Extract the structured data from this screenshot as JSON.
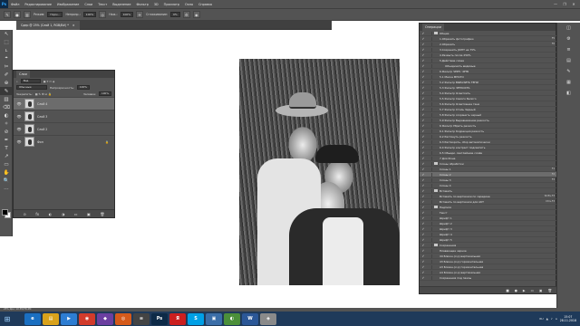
{
  "app": {
    "logo": "Ps",
    "menu": [
      "Файл",
      "Редактирование",
      "Изображение",
      "Слои",
      "Текст",
      "Выделение",
      "Фильтр",
      "3D",
      "Просмотр",
      "Окно",
      "Справка"
    ],
    "window_controls": [
      "—",
      "❐",
      "✕"
    ]
  },
  "options": {
    "mode_label": "Режим:",
    "mode_value": "Норм...",
    "opacity_label": "Непрозр.:",
    "opacity_value": "100%",
    "flow_label": "Наж.:",
    "flow_value": "100%",
    "smooth_label": "Сглаживание:",
    "smooth_value": "0%"
  },
  "document": {
    "tab_label": "Сдер @ 25% (Слой 1, RGB/8#) *",
    "close": "×"
  },
  "tools": [
    "↖",
    "⬚",
    "ʟ",
    "⌖",
    "✂",
    "✐",
    "⊕",
    "✎",
    "▥",
    "⌫",
    "◐",
    "✧",
    "⊘",
    "✒",
    "T",
    "↗",
    "▭",
    "✋",
    "🔍",
    "⋯"
  ],
  "layers_panel": {
    "tab": "Слои",
    "kind_label": "Вид",
    "blend_mode": "Обычные",
    "opacity_label": "Непрозрачность:",
    "opacity_value": "100%",
    "lock_label": "Закрепить:",
    "fill_label": "Заливка:",
    "fill_value": "100%",
    "layers": [
      {
        "name": "Слой 4",
        "selected": true
      },
      {
        "name": "Слой 3",
        "selected": false
      },
      {
        "name": "Слой 2",
        "selected": false
      },
      {
        "name": "Фон",
        "selected": false
      }
    ],
    "footer_icons": [
      "⊙",
      "fx",
      "◐",
      "◑",
      "▭",
      "▣",
      "🗑"
    ]
  },
  "actions_panel": {
    "tab": "Операции",
    "items": [
      {
        "level": 0,
        "folder": true,
        "name": "Общие",
        "key": ""
      },
      {
        "level": 1,
        "name": "1.Обрезать фотографию",
        "key": "F5"
      },
      {
        "level": 1,
        "name": "2.Обрезать",
        "key": "F6"
      },
      {
        "level": 1,
        "name": "3.Сохранить JOIHT на 75%",
        "key": ""
      },
      {
        "level": 1,
        "name": "4.Размыть после 250%",
        "key": ""
      },
      {
        "level": 1,
        "name": "5.Действие слоев",
        "key": ""
      },
      {
        "level": 2,
        "name": "Объединить видимые",
        "key": ""
      },
      {
        "level": 1,
        "name": "6.Фильтр ЧЕРН. ЧРТБ",
        "key": ""
      },
      {
        "level": 1,
        "name": "5.1 Маска МНОГО",
        "key": ""
      },
      {
        "level": 1,
        "name": "5.2 Фильтр ВЫРАЗИТЬ ТЕНИ",
        "key": ""
      },
      {
        "level": 1,
        "name": "5.3 Фильтр ЧЕТКОСТЬ",
        "key": ""
      },
      {
        "level": 1,
        "name": "5.4 Фильтр Осветлить",
        "key": ""
      },
      {
        "level": 1,
        "name": "5.5 Фильтр Самого Белого",
        "key": ""
      },
      {
        "level": 1,
        "name": "5.6 Фильтр Осветление тени",
        "key": ""
      },
      {
        "level": 1,
        "name": "5.7 Фильтр Стиль Черный",
        "key": ""
      },
      {
        "level": 1,
        "name": "5.8 Фильтр сохранить черный",
        "key": ""
      },
      {
        "level": 1,
        "name": "5.9 Фильтр Выравнивание резкость",
        "key": ""
      },
      {
        "level": 1,
        "name": "6 Фильтр Убрать резкость",
        "key": ""
      },
      {
        "level": 1,
        "name": "6.1 Фильтр Коррекция резкость",
        "key": ""
      },
      {
        "level": 1,
        "name": "6.2 Растянуть резкость",
        "key": ""
      },
      {
        "level": 1,
        "name": "6.3 Растворить, сбор автоматически",
        "key": ""
      },
      {
        "level": 1,
        "name": "6.4 Фильтр контраст подсветить",
        "key": ""
      },
      {
        "level": 1,
        "name": "6.5 Обьеди. светлейшие слоёв",
        "key": ""
      },
      {
        "level": 1,
        "name": "7 Для Фона",
        "key": ""
      },
      {
        "level": 0,
        "folder": true,
        "name": "Слоны обработки",
        "key": ""
      },
      {
        "level": 1,
        "name": "Слоны 1",
        "key": "F1"
      },
      {
        "level": 1,
        "name": "Слоны 2",
        "key": "F2",
        "selected": true
      },
      {
        "level": 1,
        "name": "Слоны 3",
        "key": "F3"
      },
      {
        "level": 1,
        "name": "Слоны 4",
        "key": ""
      },
      {
        "level": 0,
        "folder": true,
        "name": "Вставить",
        "key": ""
      },
      {
        "level": 1,
        "name": "Вставить по вертикали по середине",
        "key": "Shift+F3"
      },
      {
        "level": 1,
        "name": "Вставить по вертикали для АКТ",
        "key": "Ctrl+F3"
      },
      {
        "level": 0,
        "folder": true,
        "name": "Надписи",
        "key": ""
      },
      {
        "level": 1,
        "name": "Текст",
        "key": ""
      },
      {
        "level": 1,
        "name": "Шрифт 1",
        "key": ""
      },
      {
        "level": 1,
        "name": "Шрифт 2",
        "key": ""
      },
      {
        "level": 1,
        "name": "Шрифт 3",
        "key": ""
      },
      {
        "level": 1,
        "name": "Шрифт 4",
        "key": ""
      },
      {
        "level": 1,
        "name": "Шрифт 5",
        "key": ""
      },
      {
        "level": 0,
        "folder": true,
        "name": "Сохранения",
        "key": ""
      },
      {
        "level": 1,
        "name": "Плавающее черное",
        "key": ""
      },
      {
        "level": 1,
        "name": "44 Ближн.(л.р) вертикальная",
        "key": ""
      },
      {
        "level": 1,
        "name": "43 Ближн.(л.р) горизонтальная",
        "key": ""
      },
      {
        "level": 1,
        "name": "A3 Ближн.(л.р) горизонтальная",
        "key": ""
      },
      {
        "level": 1,
        "name": "A4 Ближн.(л.р) вертикальная",
        "key": ""
      },
      {
        "level": 1,
        "name": "Сохранения под пазлы",
        "key": ""
      }
    ],
    "footer_icons": [
      "■",
      "●",
      "▶",
      "▭",
      "▣",
      "🗑"
    ]
  },
  "right_strip_icons": [
    "◫",
    "⚙",
    "≡",
    "▤",
    "✎",
    "▦",
    "◧"
  ],
  "statusbar": "25% Док: 10.3M/78.4M",
  "taskbar": {
    "start": "⊞",
    "apps": [
      {
        "label": "e",
        "color": "#1a6fc1"
      },
      {
        "label": "▤",
        "color": "#d9a21b"
      },
      {
        "label": "▶",
        "color": "#2d7dd2"
      },
      {
        "label": "◉",
        "color": "#d23b2b"
      },
      {
        "label": "◆",
        "color": "#6b3fa0"
      },
      {
        "label": "◎",
        "color": "#d55a1a"
      },
      {
        "label": "≡",
        "color": "#444444"
      },
      {
        "label": "Ps",
        "color": "#0d2a47"
      },
      {
        "label": "Я",
        "color": "#cc1f1f"
      },
      {
        "label": "S",
        "color": "#00a0e6"
      },
      {
        "label": "▣",
        "color": "#3b6ea8"
      },
      {
        "label": "◐",
        "color": "#4b8f3a"
      },
      {
        "label": "W",
        "color": "#2b5797"
      },
      {
        "label": "◈",
        "color": "#8a8a8a"
      }
    ],
    "tray": [
      "RU",
      "▲",
      "♪",
      "⌂"
    ],
    "time": "15:07",
    "date": "28.11.2018"
  }
}
